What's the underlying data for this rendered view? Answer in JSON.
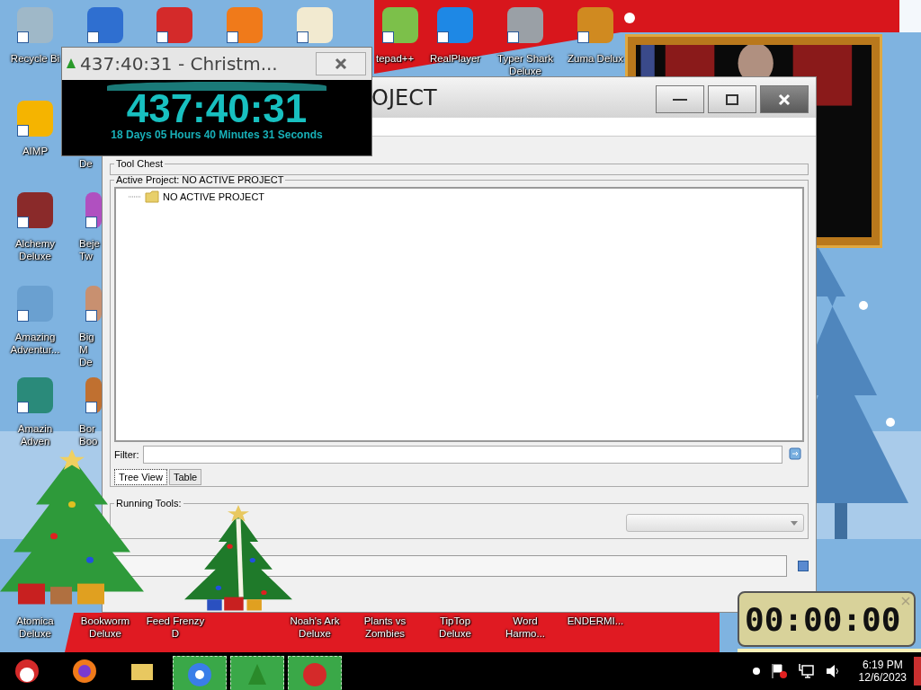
{
  "desktop_icons": [
    {
      "label": "Recycle Bi",
      "color": "#9fb8c8"
    },
    {
      "color": "#2f6fd0"
    },
    {
      "color": "#d42a2a"
    },
    {
      "color": "#f07a1a"
    },
    {
      "color": "#f2ead0"
    },
    {
      "label": "tepad++",
      "color": "#7cc04a"
    },
    {
      "label": "RealPlayer",
      "color": "#1e88e5"
    },
    {
      "label": "Typer Shark Deluxe",
      "color": "#9aa0a6"
    },
    {
      "label": "Zuma Delux",
      "color": "#d08a20"
    },
    {
      "label": "AIMP",
      "color": "#f5b400"
    },
    {
      "label": "Alchemy Deluxe",
      "color": "#8a2a2a"
    },
    {
      "label": "Amazing Adventur...",
      "color": "#6aa0d0"
    },
    {
      "label": "Amazin Adven",
      "color": "#2a8a7a"
    },
    {
      "label": "De"
    },
    {
      "label": "Beje Tw",
      "color": "#b050c0"
    },
    {
      "label": "Big M De",
      "color": "#c89070"
    },
    {
      "label": "Bor Boo",
      "color": "#c07030"
    },
    {
      "label": "Atomica Deluxe"
    },
    {
      "label": "Bookworm Deluxe"
    },
    {
      "label": "Feed Frenzy D"
    },
    {
      "label": "Noah's Ark Deluxe"
    },
    {
      "label": "Plants vs Zombies"
    },
    {
      "label": "TipTop Deluxe"
    },
    {
      "label": "Word Harmo..."
    },
    {
      "label": "ENDERMI..."
    }
  ],
  "timer_window": {
    "title": "437:40:31 - Christm...",
    "time": "437:40:31",
    "detail": "18 Days 05 Hours 40 Minutes 31 Seconds"
  },
  "main_window": {
    "title": "OJECT",
    "tool_chest": {
      "title": "Tool Chest"
    },
    "active_project": {
      "title": "Active Project: NO ACTIVE PROJECT",
      "tree": [
        {
          "label": "NO ACTIVE PROJECT"
        }
      ],
      "filter": {
        "label": "Filter:"
      },
      "tabs": [
        {
          "label": "Tree View",
          "selected": true
        },
        {
          "label": "Table",
          "selected": false
        }
      ]
    },
    "running_tools": {
      "title": "Running Tools:"
    }
  },
  "stopwatch": {
    "time": "00:00:00"
  },
  "taskbar": {
    "items": [
      {
        "kind": "santa",
        "running": false
      },
      {
        "kind": "firefox",
        "running": false
      },
      {
        "kind": "folder",
        "running": false
      },
      {
        "kind": "chrome",
        "running": true
      },
      {
        "kind": "tree",
        "running": true
      },
      {
        "kind": "dino",
        "running": true
      }
    ],
    "tray": {
      "time": "6:19 PM",
      "date": "12/6/2023"
    }
  }
}
